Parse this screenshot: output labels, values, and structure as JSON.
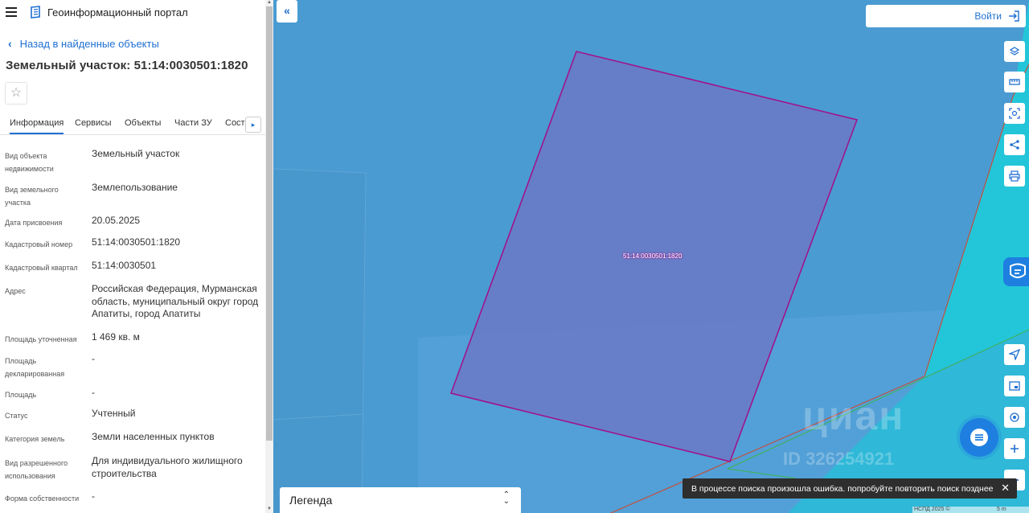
{
  "header": {
    "menu_icon": "hamburger-icon",
    "logo_icon": "portal-logo-icon",
    "title": "Геоинформационный портал"
  },
  "back_link": {
    "label": "Назад в найденные объекты"
  },
  "object": {
    "title": "Земельный участок: 51:14:0030501:1820",
    "favorite_icon": "star-icon"
  },
  "tabs": [
    {
      "label": "Информация",
      "active": true
    },
    {
      "label": "Сервисы"
    },
    {
      "label": "Объекты"
    },
    {
      "label": "Части ЗУ"
    },
    {
      "label": "Соста"
    }
  ],
  "properties": [
    {
      "key": "Вид объекта недвижимости",
      "value": "Земельный участок"
    },
    {
      "key": "Вид земельного участка",
      "value": "Землепользование"
    },
    {
      "key": "Дата присвоения",
      "value": "20.05.2025"
    },
    {
      "key": "Кадастровый номер",
      "value": "51:14:0030501:1820"
    },
    {
      "key": "Кадастровый квартал",
      "value": "51:14:0030501"
    },
    {
      "key": "Адрес",
      "value": "Российская Федерация, Мурманская область, муниципальный округ город Апатиты, город Апатиты"
    },
    {
      "key": "Площадь уточненная",
      "value": "1 469 кв. м"
    },
    {
      "key": "Площадь декларированная",
      "value": "-"
    },
    {
      "key": "Площадь",
      "value": "-"
    },
    {
      "key": "Статус",
      "value": "Учтенный"
    },
    {
      "key": "Категория земель",
      "value": "Земли населенных пунктов"
    },
    {
      "key": "Вид разрешенного использования",
      "value": "Для индивидуального жилищного строительства"
    },
    {
      "key": "Форма собственности",
      "value": "-"
    }
  ],
  "map": {
    "login_label": "Войти",
    "parcel_label": "51:14:0030501:1820",
    "legend_label": "Легенда",
    "toast_message": "В процессе поиска произошла ошибка. попробуйте повторить поиск позднее",
    "watermark_brand": "циан",
    "watermark_id": "ID 326254921",
    "attribution": "НСПД 2025 ©",
    "scale": "5 m",
    "tools": [
      "layers-icon",
      "ruler-icon",
      "select-area-icon",
      "share-icon",
      "print-icon"
    ],
    "bottom_tools": [
      "locate-icon",
      "minimap-icon",
      "geolocation-icon",
      "zoom-in-icon",
      "zoom-out-icon"
    ]
  },
  "colors": {
    "accent": "#1f6fd1",
    "parcel_stroke": "#a0148c",
    "map_water": "#4a9bd1"
  }
}
